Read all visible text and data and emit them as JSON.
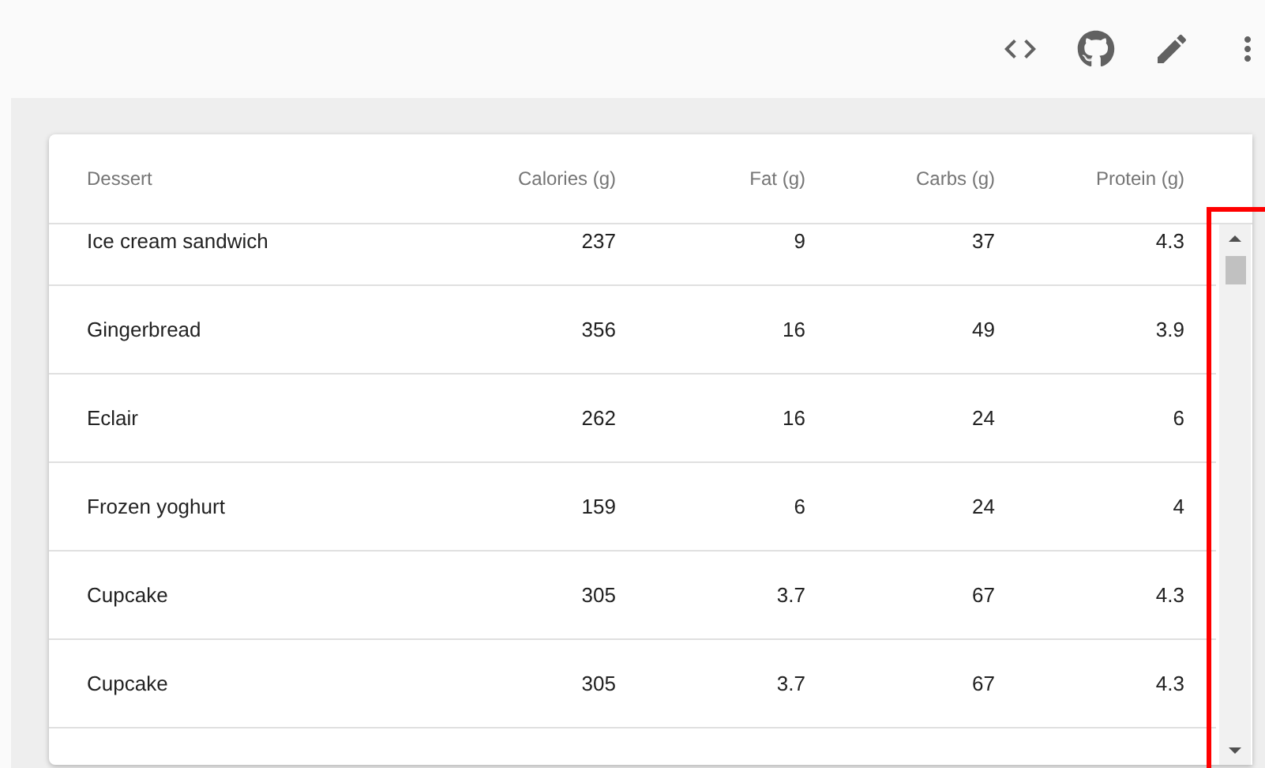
{
  "table": {
    "columns": [
      "Dessert",
      "Calories (g)",
      "Fat (g)",
      "Carbs (g)",
      "Protein (g)"
    ],
    "rows": [
      [
        "Ice cream sandwich",
        "237",
        "9",
        "37",
        "4.3"
      ],
      [
        "Gingerbread",
        "356",
        "16",
        "49",
        "3.9"
      ],
      [
        "Eclair",
        "262",
        "16",
        "24",
        "6"
      ],
      [
        "Frozen yoghurt",
        "159",
        "6",
        "24",
        "4"
      ],
      [
        "Cupcake",
        "305",
        "3.7",
        "67",
        "4.3"
      ],
      [
        "Cupcake",
        "305",
        "3.7",
        "67",
        "4.3"
      ]
    ]
  }
}
